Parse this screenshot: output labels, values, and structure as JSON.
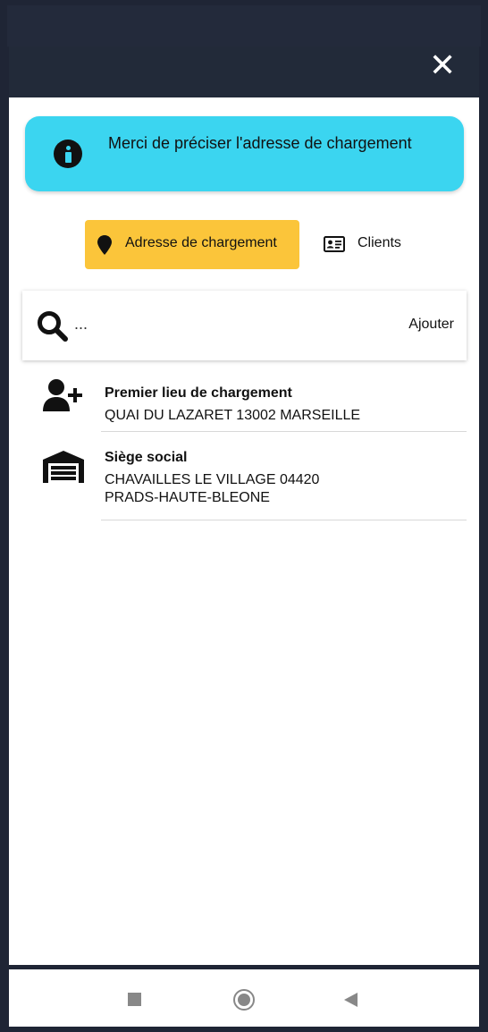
{
  "header": {
    "close_icon": "close-icon",
    "close_glyph": "✕"
  },
  "banner": {
    "icon": "info-icon",
    "text": "Merci de préciser l'adresse de chargement",
    "color": "#3bd5f0"
  },
  "tabs": [
    {
      "label": "Adresse de chargement",
      "icon": "map-pin-icon",
      "active": true,
      "color": "#fbc53a"
    },
    {
      "label": "Clients",
      "icon": "id-card-icon",
      "active": false
    }
  ],
  "search": {
    "placeholder": "...",
    "add_label": "Ajouter"
  },
  "addresses": [
    {
      "icon": "add-user-icon",
      "title": "Premier lieu de chargement",
      "lines": [
        "QUAI DU LAZARET 13002 MARSEILLE"
      ]
    },
    {
      "icon": "warehouse-icon",
      "title": "Siège social",
      "lines": [
        "CHAVAILLES LE VILLAGE 04420",
        "PRADS-HAUTE-BLEONE"
      ]
    }
  ],
  "navbar": {
    "items": [
      "recent-apps-icon",
      "home-icon",
      "back-icon"
    ]
  }
}
